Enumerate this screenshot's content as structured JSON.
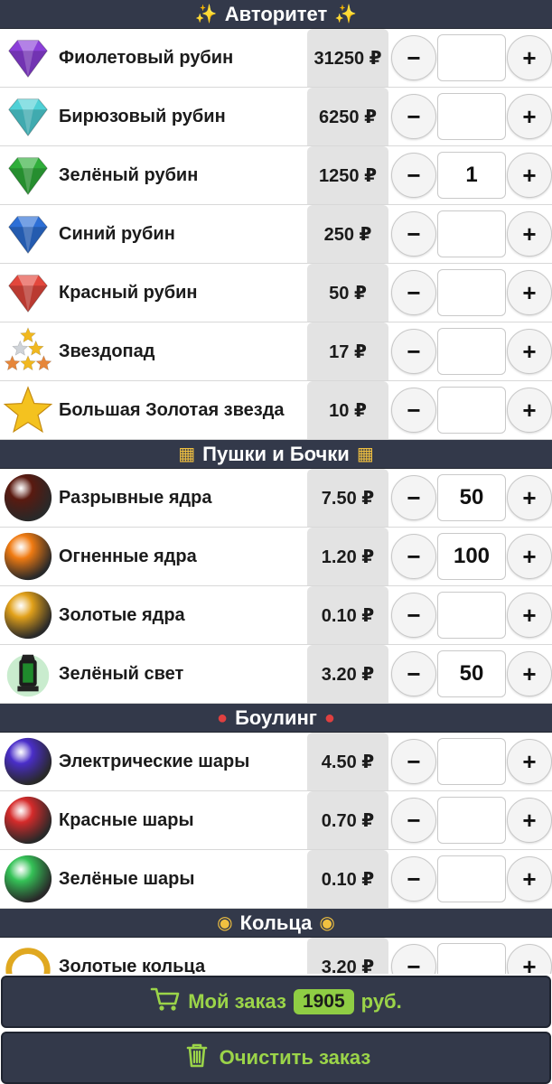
{
  "sections": [
    {
      "title": "Авторитет",
      "icon": "firework-icon",
      "items": [
        {
          "name": "Фиолетовый рубин",
          "price": "31250 ₽",
          "qty": "",
          "icon": "violet-gem-icon",
          "color": "#8b3fd9"
        },
        {
          "name": "Бирюзовый рубин",
          "price": "6250 ₽",
          "qty": "",
          "icon": "turquoise-gem-icon",
          "color": "#4fd0d6"
        },
        {
          "name": "Зелёный рубин",
          "price": "1250 ₽",
          "qty": "1",
          "icon": "green-gem-icon",
          "color": "#2fae3a"
        },
        {
          "name": "Синий рубин",
          "price": "250 ₽",
          "qty": "",
          "icon": "blue-gem-icon",
          "color": "#2d6fd6"
        },
        {
          "name": "Красный рубин",
          "price": "50 ₽",
          "qty": "",
          "icon": "red-gem-icon",
          "color": "#e3473c"
        },
        {
          "name": "Звездопад",
          "price": "17 ₽",
          "qty": "",
          "icon": "star-pile-icon",
          "color": "#f1b81f"
        },
        {
          "name": "Большая Золотая звезда",
          "price": "10 ₽",
          "qty": "",
          "icon": "gold-star-icon",
          "color": "#f4c21f"
        }
      ]
    },
    {
      "title": "Пушки и Бочки",
      "icon": "cannon-icon",
      "items": [
        {
          "name": "Разрывные ядра",
          "price": "7.50 ₽",
          "qty": "50",
          "icon": "explosive-ball-icon",
          "color": "#5a1a10"
        },
        {
          "name": "Огненные ядра",
          "price": "1.20 ₽",
          "qty": "100",
          "icon": "fire-ball-icon",
          "color": "#f07b12"
        },
        {
          "name": "Золотые ядра",
          "price": "0.10 ₽",
          "qty": "",
          "icon": "gold-ball-icon",
          "color": "#e2a11a"
        },
        {
          "name": "Зелёный свет",
          "price": "3.20 ₽",
          "qty": "50",
          "icon": "green-lantern-icon",
          "color": "#1f8a2c"
        }
      ]
    },
    {
      "title": "Боулинг",
      "icon": "bowling-icon",
      "items": [
        {
          "name": "Электрические шары",
          "price": "4.50 ₽",
          "qty": "",
          "icon": "electric-ball-icon",
          "color": "#4a2ec9"
        },
        {
          "name": "Красные шары",
          "price": "0.70 ₽",
          "qty": "",
          "icon": "red-ball-icon",
          "color": "#d52b2b"
        },
        {
          "name": "Зелёные шары",
          "price": "0.10 ₽",
          "qty": "",
          "icon": "green-ball-icon",
          "color": "#35c257"
        }
      ]
    },
    {
      "title": "Кольца",
      "icon": "money-bag-icon",
      "items": [
        {
          "name": "Золотые кольца",
          "price": "3.20 ₽",
          "qty": "",
          "icon": "gold-ring-icon",
          "color": "#e0a820"
        }
      ]
    }
  ],
  "controls": {
    "minus": "−",
    "plus": "+"
  },
  "footer": {
    "order_label": "Мой заказ",
    "order_total": "1905",
    "currency": "руб.",
    "clear_label": "Очистить заказ",
    "accent": "#9bd449",
    "bar_color": "#33394a"
  }
}
